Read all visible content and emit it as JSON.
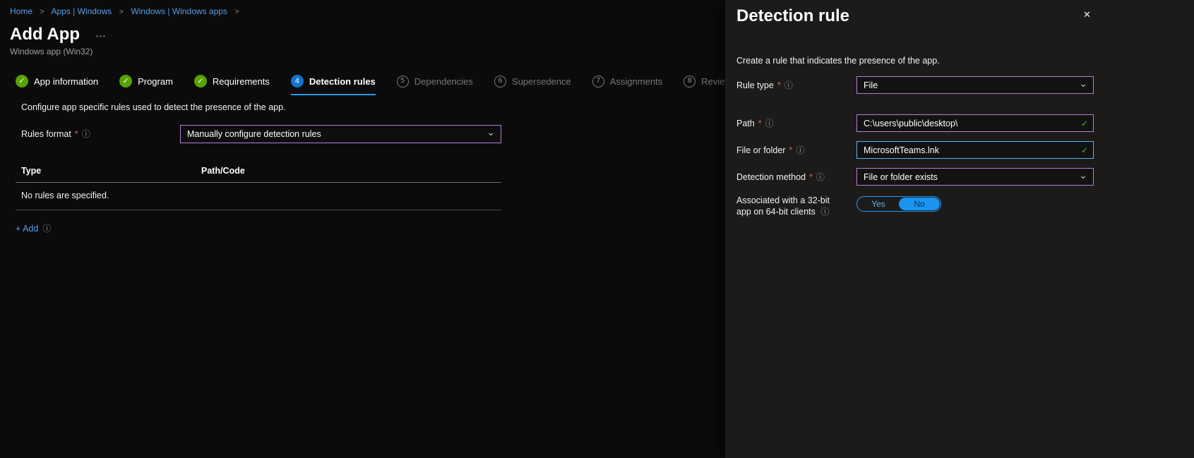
{
  "icons": {
    "check": "✓",
    "chevron_down": "⌄",
    "info": "ⓘ",
    "close": "✕",
    "more": "⋯"
  },
  "required_marker": "*",
  "breadcrumb": {
    "separator": ">",
    "items": [
      {
        "label": "Home"
      },
      {
        "label": "Apps | Windows"
      },
      {
        "label": "Windows | Windows apps"
      }
    ]
  },
  "header": {
    "title": "Add App",
    "subtitle": "Windows app (Win32)"
  },
  "wizard": {
    "steps": [
      {
        "label": "App information",
        "state": "complete"
      },
      {
        "label": "Program",
        "state": "complete"
      },
      {
        "label": "Requirements",
        "state": "complete"
      },
      {
        "number": "4",
        "label": "Detection rules",
        "state": "active"
      },
      {
        "number": "5",
        "label": "Dependencies",
        "state": "upcoming"
      },
      {
        "number": "6",
        "label": "Supersedence",
        "state": "upcoming"
      },
      {
        "number": "7",
        "label": "Assignments",
        "state": "upcoming"
      },
      {
        "number": "8",
        "label": "Review + create",
        "state": "upcoming"
      }
    ]
  },
  "main": {
    "description": "Configure app specific rules used to detect the presence of the app.",
    "rules_format_label": "Rules format",
    "rules_format_value": "Manually configure detection rules",
    "table": {
      "col_type": "Type",
      "col_path": "Path/Code",
      "empty": "No rules are specified."
    },
    "add_label": "+ Add"
  },
  "panel": {
    "title": "Detection rule",
    "description": "Create a rule that indicates the presence of the app.",
    "fields": [
      {
        "label": "Rule type",
        "value": "File"
      },
      {
        "label": "Path",
        "value": "C:\\users\\public\\desktop\\"
      },
      {
        "label": "File or folder",
        "value": "MicrosoftTeams.lnk"
      },
      {
        "label": "Detection method",
        "value": "File or folder exists"
      },
      {
        "label": "Associated with a 32-bit app on 64-bit clients",
        "options": [
          "Yes",
          "No"
        ],
        "value": "No"
      }
    ]
  },
  "colors": {
    "link_blue": "#569de5",
    "accent_blue": "#2899f5",
    "success_green": "#57a300",
    "modified_purple": "#b97bd6",
    "focus_blue": "#58aef5"
  }
}
